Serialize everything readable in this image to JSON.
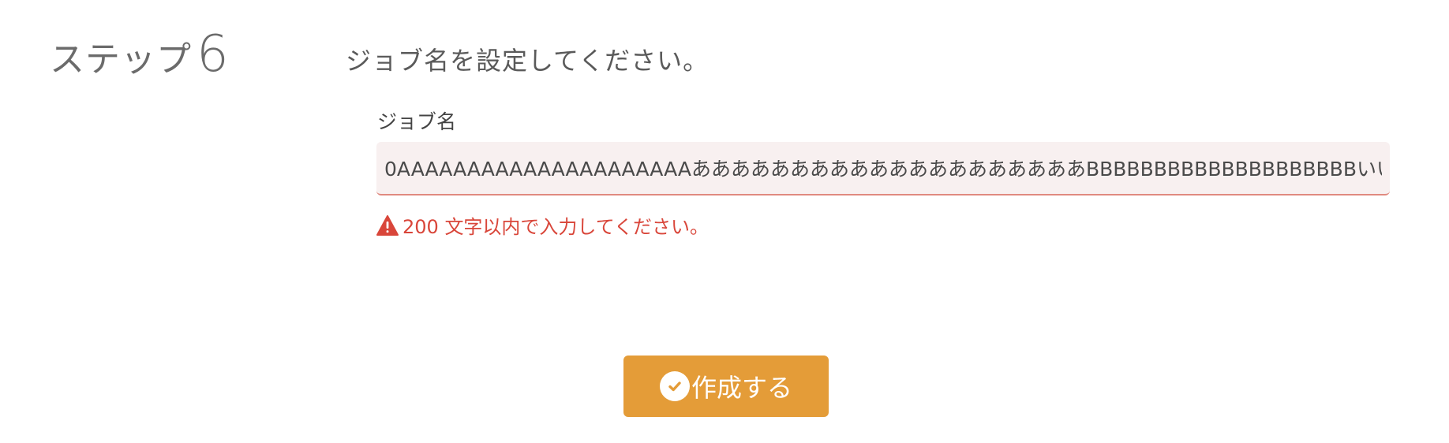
{
  "step": {
    "word": "ステップ",
    "number": "6"
  },
  "instruction": "ジョブ名を設定してください。",
  "job_name_field": {
    "label": "ジョブ名",
    "value": "0AAAAAAAAAAAAAAAAAAAAAああああああああああああああああああああBBBBBBBBBBBBBBBBBBBBいい"
  },
  "error": {
    "icon": "warning-icon",
    "message": "200 文字以内で入力してください。",
    "color": "#d9463a"
  },
  "submit_button": {
    "icon": "check-circle-icon",
    "label": "作成する",
    "color": "#e49c38"
  }
}
